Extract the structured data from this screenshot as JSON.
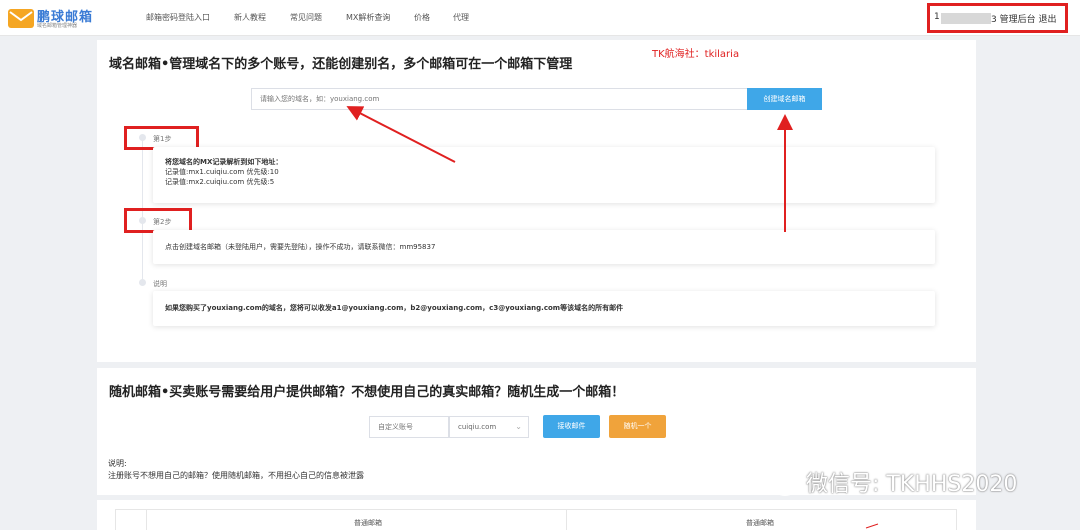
{
  "header": {
    "logo_title": "鹏球邮箱",
    "logo_subtitle": "域名邮箱管理神器",
    "nav": [
      {
        "label": "邮箱密码登陆入口"
      },
      {
        "label": "新人教程"
      },
      {
        "label": "常见问题"
      },
      {
        "label": "MX解析查询"
      },
      {
        "label": "价格"
      },
      {
        "label": "代理"
      }
    ],
    "user_prefix": "1",
    "user_suffix": "3",
    "admin_label": "管理后台",
    "logout_label": "退出"
  },
  "annotation": "TK航海社：tkilaria",
  "domain_section": {
    "title": "域名邮箱•管理域名下的多个账号，还能创建别名，多个邮箱可在一个邮箱下管理",
    "input_placeholder": "请输入您的域名，如：youxiang.com",
    "create_button": "创建域名邮箱",
    "steps": [
      {
        "label": "第1步",
        "lines": [
          "将您域名的MX记录解析到如下地址：",
          "记录值:mx1.cuiqiu.com 优先级:10",
          "记录值:mx2.cuiqiu.com 优先级:5"
        ]
      },
      {
        "label": "第2步",
        "lines": [
          "点击创建域名邮箱（未登陆用户，需要先登陆），操作不成功，请联系微信：mm95837"
        ]
      },
      {
        "label": "说明",
        "lines": [
          "如果您购买了youxiang.com的域名，您将可以收发a1@youxiang.com，b2@youxiang.com，c3@youxiang.com等该域名的所有邮件"
        ]
      }
    ]
  },
  "random_section": {
    "title": "随机邮箱•买卖账号需要给用户提供邮箱？不想使用自己的真实邮箱？随机生成一个邮箱！",
    "account_placeholder": "自定义账号",
    "domain_selected": "cuiqiu.com",
    "receive_button": "接收邮件",
    "random_button": "随机一个",
    "note_label": "说明:",
    "note_text": "注册账号不想用自己的邮箱？使用随机邮箱，不用担心自己的信息被泄露"
  },
  "table": {
    "headers": [
      "普通邮箱",
      "普通邮箱"
    ]
  },
  "watermark": "微信号: TKHHS2020",
  "colors": {
    "primary": "#3fa7e8",
    "orange": "#f0a33b",
    "annotation_red": "#e02020"
  }
}
